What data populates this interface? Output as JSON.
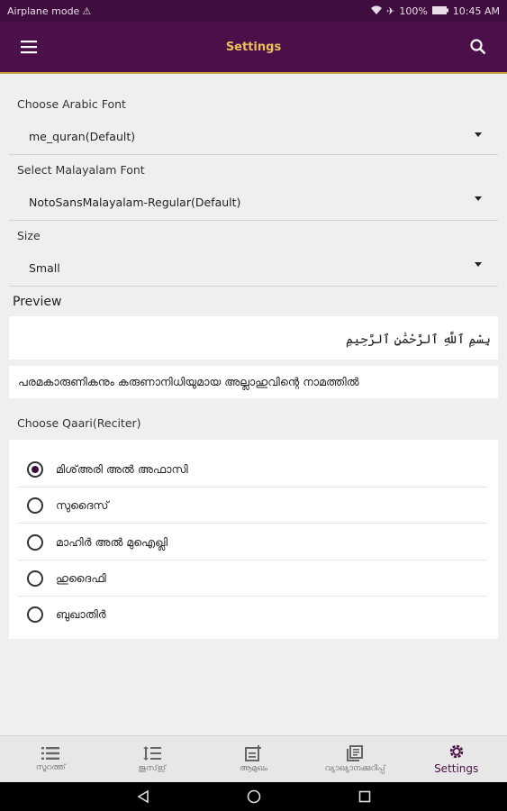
{
  "status_bar": {
    "left_text": "Airplane mode",
    "battery": "100%",
    "time": "10:45 AM"
  },
  "app_bar": {
    "title": "Settings"
  },
  "settings": {
    "arabic_font": {
      "label": "Choose Arabic Font",
      "value": "me_quran(Default)"
    },
    "malayalam_font": {
      "label": "Select Malayalam Font",
      "value": "NotoSansMalayalam-Regular(Default)"
    },
    "size": {
      "label": "Size",
      "value": "Small"
    }
  },
  "preview": {
    "title": "Preview",
    "arabic_text": "بِسْمِ ٱللَّهِ ٱلرَّحْمَٰنِ ٱلرَّحِيمِ",
    "malayalam_text": "പരമകാരുണികനും കരുണാനിധിയുമായ അല്ലാഹുവിന്റെ നാമത്തിൽ"
  },
  "qaari": {
    "label": "Choose Qaari(Reciter)",
    "reciters": [
      {
        "name": "മിശ്അരി അൽ അഫാസി",
        "selected": true
      },
      {
        "name": "സുദൈസ്",
        "selected": false
      },
      {
        "name": "മാഹിർ അൽ മുഐഖ്ലി",
        "selected": false
      },
      {
        "name": "ഹുദൈഫി",
        "selected": false
      },
      {
        "name": "ബുഖാതിർ",
        "selected": false
      }
    ]
  },
  "bottom_nav": [
    {
      "label": "സൂറത്ത്",
      "icon": "list-icon",
      "active": false
    },
    {
      "label": "ജുസ്ഇ്",
      "icon": "line-spacing-icon",
      "active": false
    },
    {
      "label": "ആമുഖം",
      "icon": "note-add-icon",
      "active": false
    },
    {
      "label": "വ്യാഖ്യാനക്കുറിപ്പ്",
      "icon": "library-books-icon",
      "active": false
    },
    {
      "label": "Settings",
      "icon": "gear-icon",
      "active": true
    }
  ],
  "colors": {
    "primary": "#4b1049",
    "accent": "#e8c15a",
    "background": "#efefef"
  }
}
